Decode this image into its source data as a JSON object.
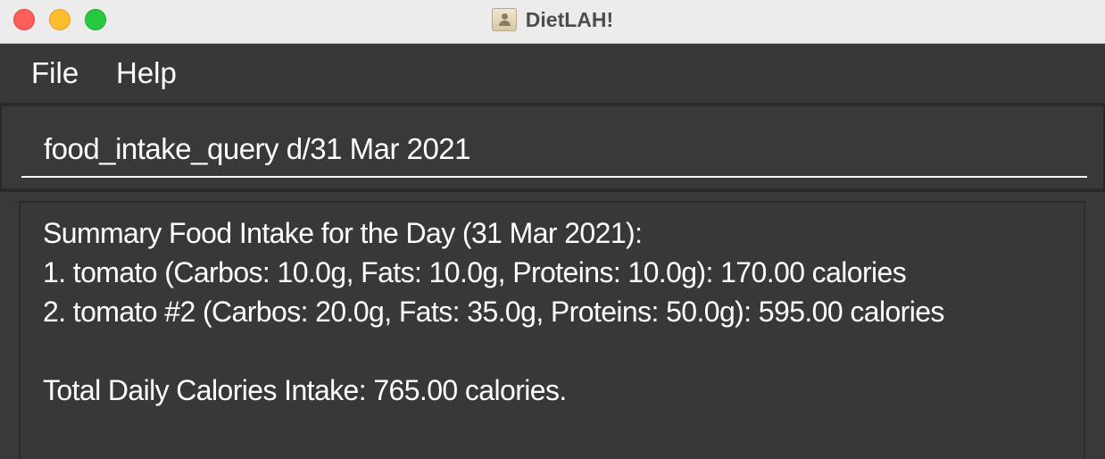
{
  "window": {
    "title": "DietLAH!",
    "controls": [
      "close",
      "minimize",
      "maximize"
    ],
    "app_icon": "contacts-card-icon"
  },
  "menu": {
    "items": [
      {
        "label": "File"
      },
      {
        "label": "Help"
      }
    ]
  },
  "command_box": {
    "value": "food_intake_query d/31 Mar 2021"
  },
  "result": {
    "lines": [
      "Summary Food Intake for the Day (31 Mar 2021):",
      "1. tomato (Carbos: 10.0g, Fats: 10.0g, Proteins: 10.0g): 170.00 calories",
      "2. tomato #2 (Carbos: 20.0g, Fats: 35.0g, Proteins: 50.0g): 595.00 calories",
      "Total Daily Calories Intake: 765.00 calories."
    ]
  },
  "colors": {
    "background": "#383838",
    "text": "#ffffff",
    "titlebar": "#ececec",
    "close": "#fe5f57",
    "minimize": "#febc2e",
    "maximize": "#28c840"
  }
}
